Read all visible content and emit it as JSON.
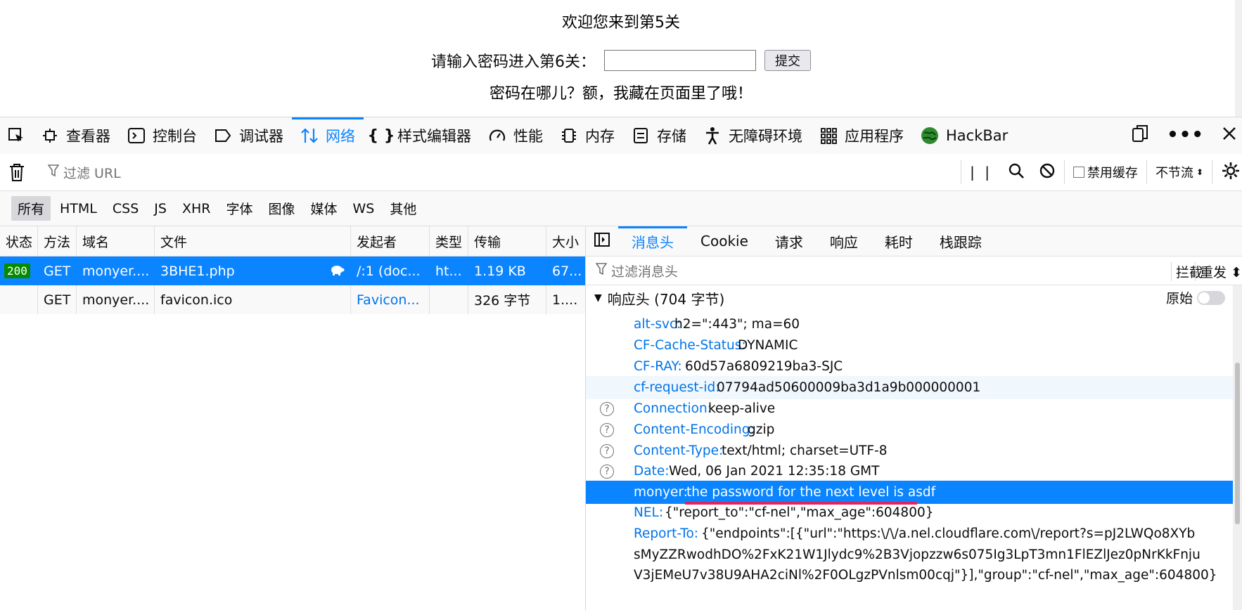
{
  "page": {
    "welcome": "欢迎您来到第5关",
    "prompt": "请输入密码进入第6关：",
    "password_value": "",
    "submit_label": "提交",
    "hint": "密码在哪儿？额，我藏在页面里了哦！"
  },
  "devtools": {
    "tabs": [
      {
        "label": "查看器",
        "icon": "inspector-icon"
      },
      {
        "label": "控制台",
        "icon": "console-icon"
      },
      {
        "label": "调试器",
        "icon": "debugger-icon"
      },
      {
        "label": "网络",
        "icon": "network-icon",
        "active": true
      },
      {
        "label": "样式编辑器",
        "icon": "braces-icon"
      },
      {
        "label": "性能",
        "icon": "gauge-icon"
      },
      {
        "label": "内存",
        "icon": "memory-chip-icon"
      },
      {
        "label": "存储",
        "icon": "storage-icon"
      },
      {
        "label": "无障碍环境",
        "icon": "accessibility-icon"
      },
      {
        "label": "应用程序",
        "icon": "grid-apps-icon"
      },
      {
        "label": "HackBar",
        "icon": "hackbar-globe-icon"
      }
    ],
    "accent": "#0a84ff"
  },
  "filterbar": {
    "placeholder": "过滤 URL",
    "disable_cache": "禁用缓存",
    "throttle": "不节流"
  },
  "types": [
    "所有",
    "HTML",
    "CSS",
    "JS",
    "XHR",
    "字体",
    "图像",
    "媒体",
    "WS",
    "其他"
  ],
  "requests": {
    "columns": [
      "状态",
      "方法",
      "域名",
      "文件",
      "发起者",
      "类型",
      "传输",
      "大小"
    ],
    "rows": [
      {
        "status": "200",
        "method": "GET",
        "domain": "monyer....",
        "file": "3BHE1.php",
        "initiator": "/:1 (doc...",
        "type": "ht...",
        "transfer": "1.19 KB",
        "size": "67..."
      },
      {
        "status": "",
        "method": "GET",
        "domain": "monyer....",
        "file": "favicon.ico",
        "initiator": "Favicon...",
        "type": "",
        "transfer": "326 字节",
        "size": "1...."
      }
    ]
  },
  "details": {
    "tabs": [
      "消息头",
      "Cookie",
      "请求",
      "响应",
      "耗时",
      "栈跟踪"
    ],
    "filter_placeholder": "过滤消息头",
    "block": "拦截",
    "resend": "重发",
    "section": "响应头 (704 字节)",
    "raw": "原始",
    "headers": [
      {
        "name": "alt-svc:",
        "value": "h2=\":443\"; ma=60",
        "help": false
      },
      {
        "name": "CF-Cache-Status:",
        "value": "DYNAMIC",
        "help": false
      },
      {
        "name": "CF-RAY:",
        "value": "60d57a6809219ba3-SJC",
        "help": false
      },
      {
        "name": "cf-request-id:",
        "value": "07794ad50600009ba3d1a9b000000001",
        "help": false
      },
      {
        "name": "Connection:",
        "value": "keep-alive",
        "help": true
      },
      {
        "name": "Content-Encoding:",
        "value": "gzip",
        "help": true
      },
      {
        "name": "Content-Type:",
        "value": "text/html; charset=UTF-8",
        "help": true
      },
      {
        "name": "Date:",
        "value": "Wed, 06 Jan 2021 12:35:18 GMT",
        "help": true
      },
      {
        "name": "monyer:",
        "value": "the password for the next level is asdf",
        "help": false
      },
      {
        "name": "NEL:",
        "value": "{\"report_to\":\"cf-nel\",\"max_age\":604800}",
        "help": false
      },
      {
        "name": "Report-To:",
        "value": "{\"endpoints\":[{\"url\":\"https:\\/\\/a.nel.cloudflare.com\\/report?s=pJ2LWQo8XYb",
        "help": false
      }
    ],
    "report_cont_1": "sMyZZRwodhDO%2FxK21W1Jlydc9%2B3Vjopzzw6s075Ig3LpT3mn1FlEZlJez0pNrKkFnju",
    "report_cont_2": "V3jEMeU7v38U9AHA2ciNl%2F0OLgzPVnlsm00cqj\"}],\"group\":\"cf-nel\",\"max_age\":604800}"
  }
}
